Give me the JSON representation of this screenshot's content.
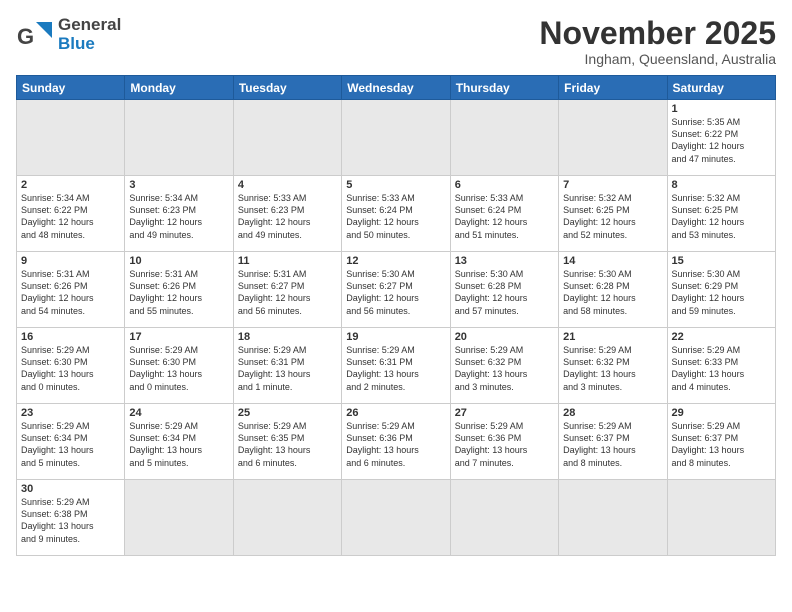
{
  "header": {
    "logo_general": "General",
    "logo_blue": "Blue",
    "month_title": "November 2025",
    "location": "Ingham, Queensland, Australia"
  },
  "weekdays": [
    "Sunday",
    "Monday",
    "Tuesday",
    "Wednesday",
    "Thursday",
    "Friday",
    "Saturday"
  ],
  "days": [
    {
      "num": "",
      "info": ""
    },
    {
      "num": "",
      "info": ""
    },
    {
      "num": "",
      "info": ""
    },
    {
      "num": "",
      "info": ""
    },
    {
      "num": "",
      "info": ""
    },
    {
      "num": "",
      "info": ""
    },
    {
      "num": "1",
      "info": "Sunrise: 5:35 AM\nSunset: 6:22 PM\nDaylight: 12 hours\nand 47 minutes."
    }
  ],
  "week2": [
    {
      "num": "2",
      "info": "Sunrise: 5:34 AM\nSunset: 6:22 PM\nDaylight: 12 hours\nand 48 minutes."
    },
    {
      "num": "3",
      "info": "Sunrise: 5:34 AM\nSunset: 6:23 PM\nDaylight: 12 hours\nand 49 minutes."
    },
    {
      "num": "4",
      "info": "Sunrise: 5:33 AM\nSunset: 6:23 PM\nDaylight: 12 hours\nand 49 minutes."
    },
    {
      "num": "5",
      "info": "Sunrise: 5:33 AM\nSunset: 6:24 PM\nDaylight: 12 hours\nand 50 minutes."
    },
    {
      "num": "6",
      "info": "Sunrise: 5:33 AM\nSunset: 6:24 PM\nDaylight: 12 hours\nand 51 minutes."
    },
    {
      "num": "7",
      "info": "Sunrise: 5:32 AM\nSunset: 6:25 PM\nDaylight: 12 hours\nand 52 minutes."
    },
    {
      "num": "8",
      "info": "Sunrise: 5:32 AM\nSunset: 6:25 PM\nDaylight: 12 hours\nand 53 minutes."
    }
  ],
  "week3": [
    {
      "num": "9",
      "info": "Sunrise: 5:31 AM\nSunset: 6:26 PM\nDaylight: 12 hours\nand 54 minutes."
    },
    {
      "num": "10",
      "info": "Sunrise: 5:31 AM\nSunset: 6:26 PM\nDaylight: 12 hours\nand 55 minutes."
    },
    {
      "num": "11",
      "info": "Sunrise: 5:31 AM\nSunset: 6:27 PM\nDaylight: 12 hours\nand 56 minutes."
    },
    {
      "num": "12",
      "info": "Sunrise: 5:30 AM\nSunset: 6:27 PM\nDaylight: 12 hours\nand 56 minutes."
    },
    {
      "num": "13",
      "info": "Sunrise: 5:30 AM\nSunset: 6:28 PM\nDaylight: 12 hours\nand 57 minutes."
    },
    {
      "num": "14",
      "info": "Sunrise: 5:30 AM\nSunset: 6:28 PM\nDaylight: 12 hours\nand 58 minutes."
    },
    {
      "num": "15",
      "info": "Sunrise: 5:30 AM\nSunset: 6:29 PM\nDaylight: 12 hours\nand 59 minutes."
    }
  ],
  "week4": [
    {
      "num": "16",
      "info": "Sunrise: 5:29 AM\nSunset: 6:30 PM\nDaylight: 13 hours\nand 0 minutes."
    },
    {
      "num": "17",
      "info": "Sunrise: 5:29 AM\nSunset: 6:30 PM\nDaylight: 13 hours\nand 0 minutes."
    },
    {
      "num": "18",
      "info": "Sunrise: 5:29 AM\nSunset: 6:31 PM\nDaylight: 13 hours\nand 1 minute."
    },
    {
      "num": "19",
      "info": "Sunrise: 5:29 AM\nSunset: 6:31 PM\nDaylight: 13 hours\nand 2 minutes."
    },
    {
      "num": "20",
      "info": "Sunrise: 5:29 AM\nSunset: 6:32 PM\nDaylight: 13 hours\nand 3 minutes."
    },
    {
      "num": "21",
      "info": "Sunrise: 5:29 AM\nSunset: 6:32 PM\nDaylight: 13 hours\nand 3 minutes."
    },
    {
      "num": "22",
      "info": "Sunrise: 5:29 AM\nSunset: 6:33 PM\nDaylight: 13 hours\nand 4 minutes."
    }
  ],
  "week5": [
    {
      "num": "23",
      "info": "Sunrise: 5:29 AM\nSunset: 6:34 PM\nDaylight: 13 hours\nand 5 minutes."
    },
    {
      "num": "24",
      "info": "Sunrise: 5:29 AM\nSunset: 6:34 PM\nDaylight: 13 hours\nand 5 minutes."
    },
    {
      "num": "25",
      "info": "Sunrise: 5:29 AM\nSunset: 6:35 PM\nDaylight: 13 hours\nand 6 minutes."
    },
    {
      "num": "26",
      "info": "Sunrise: 5:29 AM\nSunset: 6:36 PM\nDaylight: 13 hours\nand 6 minutes."
    },
    {
      "num": "27",
      "info": "Sunrise: 5:29 AM\nSunset: 6:36 PM\nDaylight: 13 hours\nand 7 minutes."
    },
    {
      "num": "28",
      "info": "Sunrise: 5:29 AM\nSunset: 6:37 PM\nDaylight: 13 hours\nand 8 minutes."
    },
    {
      "num": "29",
      "info": "Sunrise: 5:29 AM\nSunset: 6:37 PM\nDaylight: 13 hours\nand 8 minutes."
    }
  ],
  "week6": [
    {
      "num": "30",
      "info": "Sunrise: 5:29 AM\nSunset: 6:38 PM\nDaylight: 13 hours\nand 9 minutes."
    },
    {
      "num": "",
      "info": ""
    },
    {
      "num": "",
      "info": ""
    },
    {
      "num": "",
      "info": ""
    },
    {
      "num": "",
      "info": ""
    },
    {
      "num": "",
      "info": ""
    },
    {
      "num": "",
      "info": ""
    }
  ]
}
